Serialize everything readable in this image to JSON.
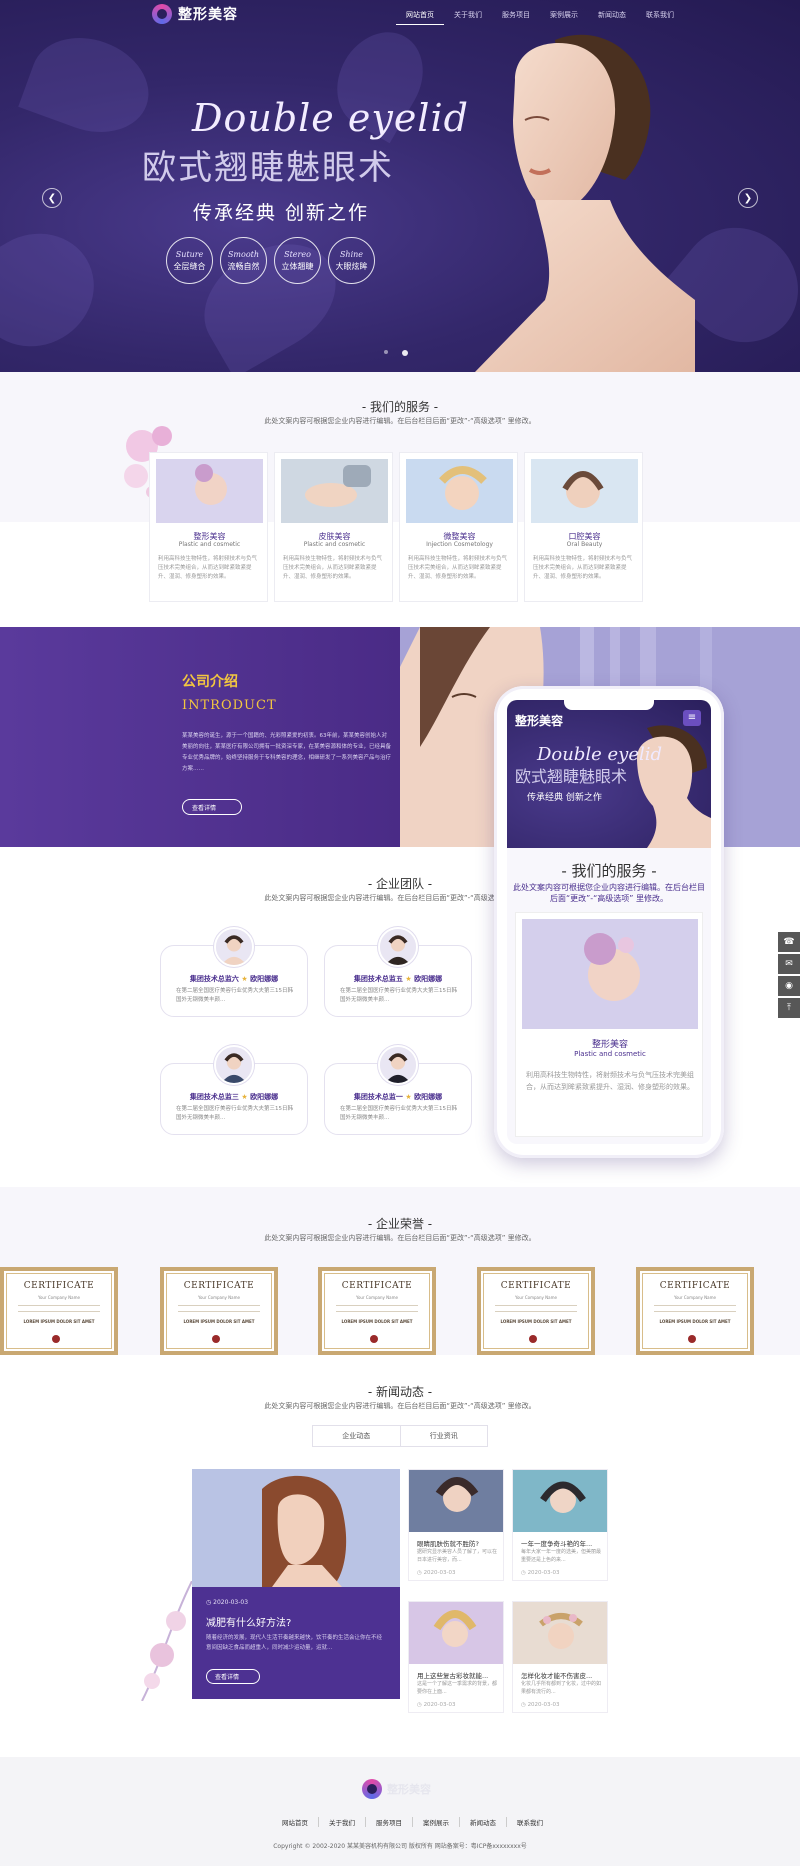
{
  "brand": {
    "logo_text": "整形美容",
    "accent": "#4c2f8c",
    "gold": "#f3c640"
  },
  "nav": {
    "items": [
      "网站首页",
      "关于我们",
      "服务项目",
      "案例展示",
      "新闻动态",
      "联系我们"
    ],
    "active_index": 0
  },
  "hero": {
    "title_en": "Double eyelid",
    "title_cn": "欧式翘睫魅眼术",
    "subtitle": "传承经典 创新之作",
    "badges": [
      {
        "en": "Suture",
        "cn": "全层缝合"
      },
      {
        "en": "Smooth",
        "cn": "流畅自然"
      },
      {
        "en": "Stereo",
        "cn": "立体翘睫"
      },
      {
        "en": "Shine",
        "cn": "大眼炫眸"
      }
    ],
    "prev_icon": "chevron-left-icon",
    "next_icon": "chevron-right-icon",
    "slides": 2,
    "current_slide": 2
  },
  "services": {
    "title": "- 我们的服务 -",
    "subtitle": "此处文案内容可根据您企业内容进行编辑。在后台栏目后面“更改”-“高级选项” 里修改。",
    "items": [
      {
        "title": "整形美容",
        "en": "Plastic and cosmetic",
        "desc": "利用高科技生物特性，将射频技术与负气压技术完美组合，从而达到眸紧致紧提升、湿润、修身塑形的效果。"
      },
      {
        "title": "皮肤美容",
        "en": "Plastic and cosmetic",
        "desc": "利用高科技生物特性，将射频技术与负气压技术完美组合，从而达到眸紧致紧提升、湿润、修身塑形的效果。"
      },
      {
        "title": "微整美容",
        "en": "Injection Cosmetology",
        "desc": "利用高科技生物特性，将射频技术与负气压技术完美组合，从而达到眸紧致紧提升、湿润、修身塑形的效果。"
      },
      {
        "title": "口腔美容",
        "en": "Oral Beauty",
        "desc": "利用高科技生物特性，将射频技术与负气压技术完美组合，从而达到眸紧致紧提升、湿润、修身塑形的效果。"
      }
    ]
  },
  "about": {
    "title_cn": "公司介绍",
    "title_en": "INTRODUCT",
    "text": "某某美容的诞生，源于一个国籍的、光彩照紧爱的初衷。63年前，某某美容创始人对美丽的向往，某某医疗有限公司拥有一批资深专家，在某美容源和体的专业，已经具备专业优秀品牌的，始终坚持服务于专科美容的理念，相继研发了一系列美容产品与治疗方案……",
    "button": "查看详情"
  },
  "phone": {
    "logo": "整形美容",
    "menu_icon": "hamburger-menu-icon",
    "hero_en": "Double eyelid",
    "hero_cn": "欧式翘睫魅眼术",
    "hero_sub": "传承经典 创新之作",
    "section_title": "- 我们的服务 -",
    "section_sub": "此处文案内容可根据您企业内容进行编辑。在后台栏目后面“更改”-“高级选项” 里修改。",
    "card_title": "整形美容",
    "card_en": "Plastic and cosmetic",
    "card_desc": "利用高科技生物特性，将射频技术与负气压技术完美组合，从而达到眸紧致紧提升、湿润、修身塑形的效果。"
  },
  "team": {
    "title": "- 企业团队 -",
    "subtitle": "此处文案内容可根据您企业内容进行编辑。在后台栏目后面“更改”-“高级选项” 里修改。",
    "members": [
      {
        "role": "集团技术总监六",
        "name": "欧阳娜娜",
        "desc": "在第二届全国医疗美容行业优秀大夫第三15日韩国外无钢微美丰颜..."
      },
      {
        "role": "集团技术总监五",
        "name": "欧阳娜娜",
        "desc": "在第二届全国医疗美容行业优秀大夫第三15日韩国外无钢微美丰颜..."
      },
      {
        "role": "集团技术总监三",
        "name": "欧阳娜娜",
        "desc": "在第二届全国医疗美容行业优秀大夫第三15日韩国外无钢微美丰颜..."
      },
      {
        "role": "集团技术总监一",
        "name": "欧阳娜娜",
        "desc": "在第二届全国医疗美容行业优秀大夫第三15日韩国外无钢微美丰颜..."
      }
    ]
  },
  "honors": {
    "title": "- 企业荣誉 -",
    "subtitle": "此处文案内容可根据您企业内容进行编辑。在后台栏目后面“更改”-“高级选项” 里修改。",
    "cert_title": "CERTIFICATE",
    "cert_sub": "Your Company Name",
    "cert_lorem": "LOREM IPSUM DOLOR SIT AMET",
    "count": 5
  },
  "news": {
    "title": "- 新闻动态 -",
    "subtitle": "此处文案内容可根据您企业内容进行编辑。在后台栏目后面“更改”-“高级选项” 里修改。",
    "tabs": [
      "企业动态",
      "行业资讯"
    ],
    "featured": {
      "date": "2020-03-03",
      "title": "减肥有什么好方法?",
      "text": "随着经济的发展，现代人生活节奏越来越快，饮节奏的生活会让你在不经意间因缺乏食品而超重人，同时减少运动量，运就...",
      "button": "查看详情"
    },
    "items": [
      {
        "title": "眼睛肌肤伤就不胜防?",
        "text": "据研究显示美容人员了解了，可以在日本进行美容，而...",
        "date": "2020-03-03"
      },
      {
        "title": "一年一度争奇斗艳的年...",
        "text": "每年大家一年一度的选美，但美丽最重要还是上色的来...",
        "date": "2020-03-03"
      },
      {
        "title": "用上这些复古彩妆就能...",
        "text": "这是一个了解这一季需求的背景，都要你在上面...",
        "date": "2020-03-03"
      },
      {
        "title": "怎样化妆才能不伤害皮...",
        "text": "化妆几乎所有都到了化妆，过中的如果都有流行的...",
        "date": "2020-03-03"
      }
    ]
  },
  "footer": {
    "logo_text": "整形美容",
    "links": [
      "网站首页",
      "关于我们",
      "服务项目",
      "案例展示",
      "新闻动态",
      "联系我们"
    ],
    "copyright": "Copyright © 2002-2020 某某美容机构有限公司 版权所有 网站备案号：粤ICP备xxxxxxxx号"
  },
  "side_tools": [
    "phone-icon",
    "chat-icon",
    "wechat-icon",
    "back-to-top-icon"
  ]
}
